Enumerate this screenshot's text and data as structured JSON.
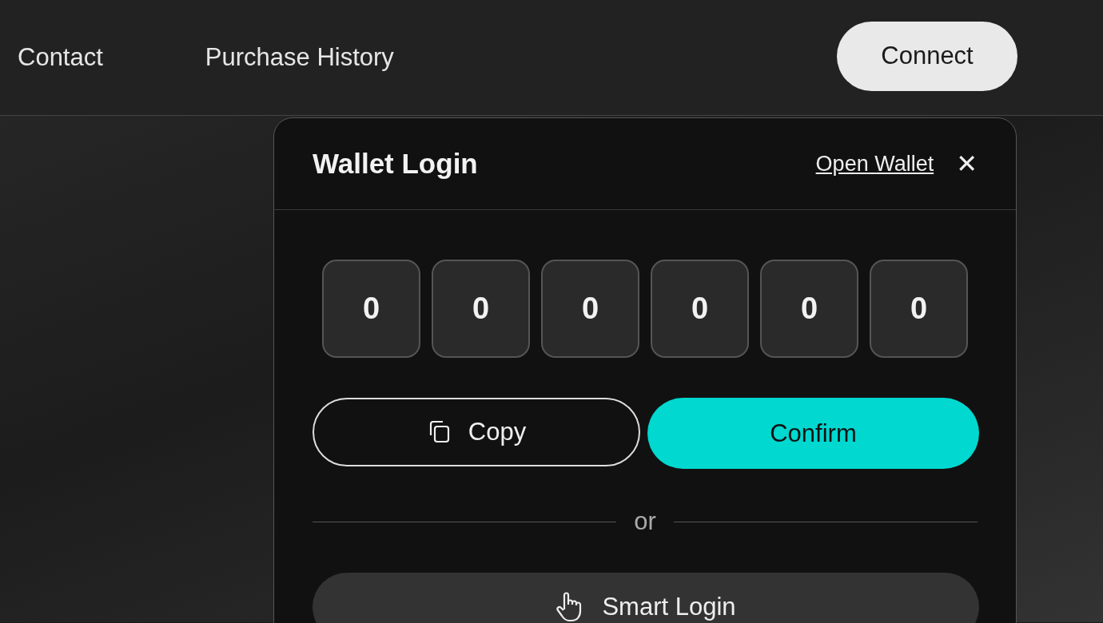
{
  "nav": {
    "links": [
      "Contact",
      "Purchase History"
    ],
    "connect_button": "Connect"
  },
  "modal": {
    "title": "Wallet Login",
    "open_wallet_link": "Open Wallet",
    "close": "✕",
    "code_digits": [
      "0",
      "0",
      "0",
      "0",
      "0",
      "0"
    ],
    "copy_button": "Copy",
    "confirm_button": "Confirm",
    "divider_text": "or",
    "smart_login_button": "Smart Login"
  }
}
